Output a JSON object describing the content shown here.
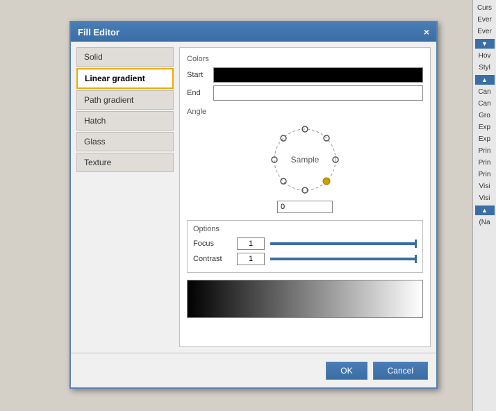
{
  "dialog": {
    "title": "Fill Editor",
    "close_label": "×"
  },
  "fill_types": [
    {
      "id": "solid",
      "label": "Solid",
      "active": false
    },
    {
      "id": "linear-gradient",
      "label": "Linear gradient",
      "active": true
    },
    {
      "id": "path-gradient",
      "label": "Path gradient",
      "active": false
    },
    {
      "id": "hatch",
      "label": "Hatch",
      "active": false
    },
    {
      "id": "glass",
      "label": "Glass",
      "active": false
    },
    {
      "id": "texture",
      "label": "Texture",
      "active": false
    }
  ],
  "colors_section": {
    "header": "Colors",
    "start_label": "Start",
    "end_label": "End"
  },
  "angle_section": {
    "header": "Angle",
    "value": "0"
  },
  "options_section": {
    "header": "Options",
    "focus_label": "Focus",
    "focus_value": "1",
    "contrast_label": "Contrast",
    "contrast_value": "1"
  },
  "footer": {
    "ok_label": "OK",
    "cancel_label": "Cancel"
  },
  "right_panel": {
    "items": [
      "Curs",
      "Ever",
      "Ever",
      "Hov",
      "Styl",
      "Can",
      "Can",
      "Gro",
      "Exp",
      "Exp",
      "Prin",
      "Prin",
      "Prin",
      "Visi",
      "Visi",
      "(Na"
    ]
  }
}
